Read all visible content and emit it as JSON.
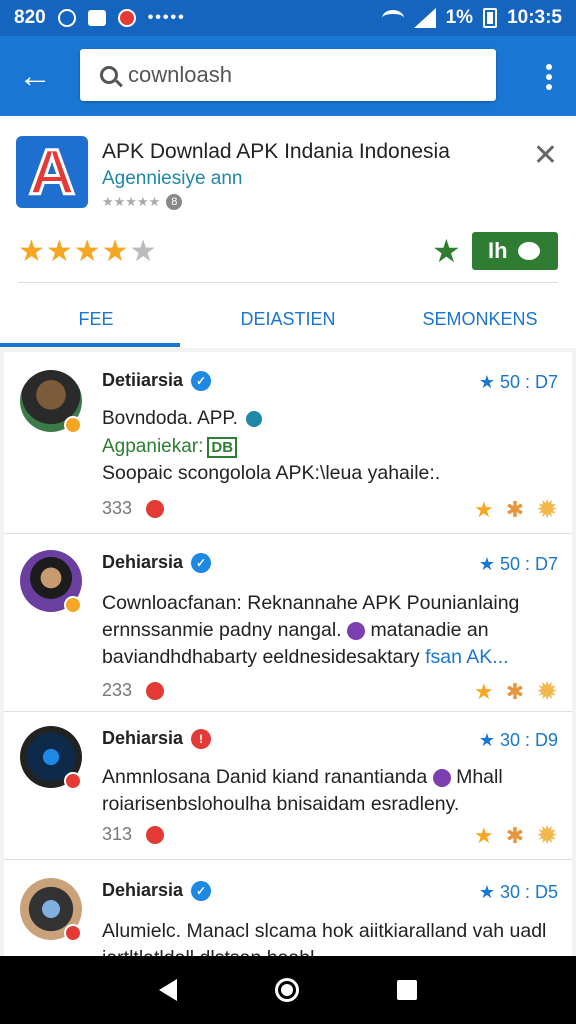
{
  "status_bar": {
    "time_left": "820",
    "time_right": "10:3:5",
    "battery": "1%"
  },
  "search": {
    "query": "cownloash"
  },
  "app": {
    "title": "APK Downlad APK Indania Indonesia",
    "developer": "Agenniesiye ann",
    "small_count": "8",
    "install_label": "Ih",
    "rating_stars": 4
  },
  "tabs": [
    "FEE",
    "DEIASTIEN",
    "SEMONKENS"
  ],
  "reviews": [
    {
      "name": "Detiiarsia",
      "date": "★ 50 : D7",
      "title": "Bovndoda. APP.",
      "subtitle": "Agpaniekar:",
      "tag": "DB",
      "body": "Soopaic scongolola APK:\\leua yahaile:.",
      "count": "333"
    },
    {
      "name": "Dehiarsia",
      "date": "★ 50 : D7",
      "body_a": "Cownloacfanan: Reknannahe APK Pounianlaing ernnssanmie padny nangal.",
      "body_b": "matanadie an baviandhdhabarty eeldnesidesaktary",
      "body_link": "fsan AK...",
      "count": "233"
    },
    {
      "name": "Dehiarsia",
      "date": "★ 30 : D9",
      "body_a": "Anmnlosana Danid kiand ranantianda",
      "body_b": "Mhall roiarisenbslohoulha bnisaidam esradleny.",
      "count": "313"
    },
    {
      "name": "Dehiarsia",
      "date": "★ 30 : D5",
      "body": "Alumielc. Manacl slcama hok aiitkiaralland vah uadl iartltlatldall dlstsan haahl"
    }
  ]
}
